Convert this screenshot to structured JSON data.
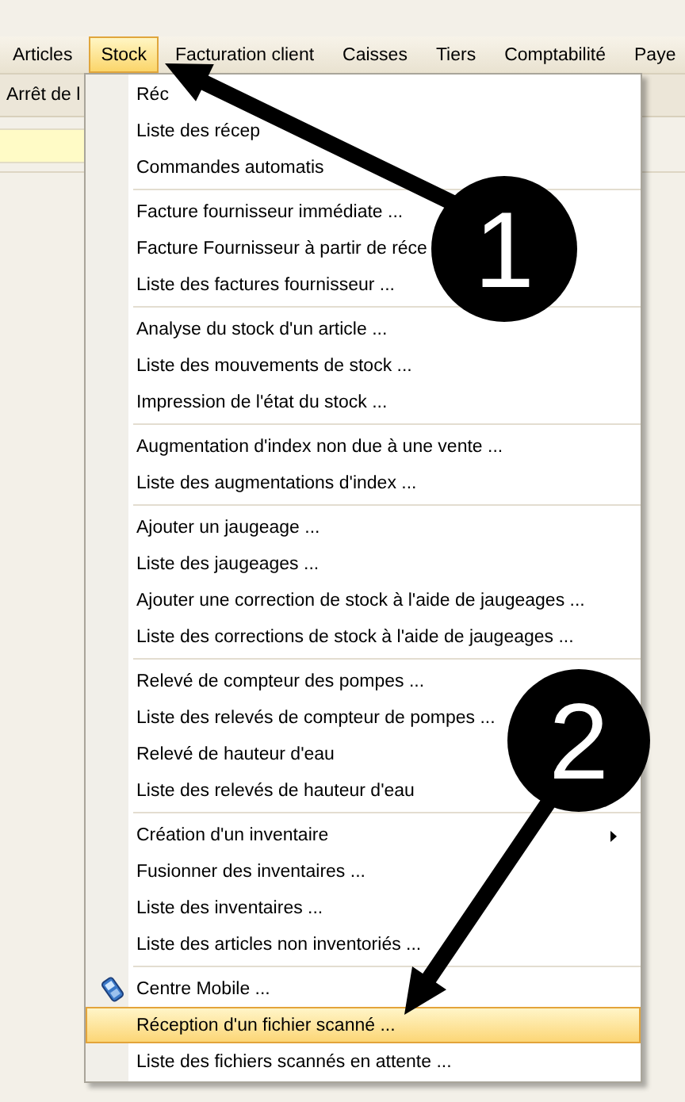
{
  "menu_bar": [
    {
      "label": "Articles",
      "selected": false
    },
    {
      "label": "Stock",
      "selected": true
    },
    {
      "label": "Facturation client",
      "selected": false
    },
    {
      "label": "Caisses",
      "selected": false
    },
    {
      "label": "Tiers",
      "selected": false
    },
    {
      "label": "Comptabilité",
      "selected": false
    },
    {
      "label": "Paye",
      "selected": false
    }
  ],
  "toolbar": {
    "button": "Arrêt de l"
  },
  "menu": [
    {
      "kind": "item",
      "label": "Réc",
      "selected": false
    },
    {
      "kind": "item",
      "label": "Liste des récep",
      "selected": false
    },
    {
      "kind": "item",
      "label": "Commandes automatis",
      "selected": false
    },
    {
      "kind": "separator"
    },
    {
      "kind": "item",
      "label": "Facture fournisseur immédiate ...",
      "selected": false
    },
    {
      "kind": "item",
      "label": "Facture Fournisseur à partir de réce",
      "selected": false
    },
    {
      "kind": "item",
      "label": "Liste des factures fournisseur ...",
      "selected": false
    },
    {
      "kind": "separator"
    },
    {
      "kind": "item",
      "label": "Analyse du stock d'un article ...",
      "selected": false
    },
    {
      "kind": "item",
      "label": "Liste des mouvements de stock ...",
      "selected": false
    },
    {
      "kind": "item",
      "label": "Impression de l'état du stock ...",
      "selected": false
    },
    {
      "kind": "separator"
    },
    {
      "kind": "item",
      "label": "Augmentation d'index non due à une vente ...",
      "selected": false
    },
    {
      "kind": "item",
      "label": "Liste des augmentations d'index ...",
      "selected": false
    },
    {
      "kind": "separator"
    },
    {
      "kind": "item",
      "label": "Ajouter un jaugeage ...",
      "selected": false
    },
    {
      "kind": "item",
      "label": "Liste des jaugeages ...",
      "selected": false
    },
    {
      "kind": "item",
      "label": "Ajouter une correction de stock à l'aide de jaugeages ...",
      "selected": false
    },
    {
      "kind": "item",
      "label": "Liste des corrections de stock à l'aide de jaugeages ...",
      "selected": false
    },
    {
      "kind": "separator"
    },
    {
      "kind": "item",
      "label": "Relevé de compteur des pompes ...",
      "selected": false
    },
    {
      "kind": "item",
      "label": "Liste des relevés de compteur de pompes ...",
      "selected": false
    },
    {
      "kind": "item",
      "label": "Relevé de hauteur d'eau",
      "selected": false
    },
    {
      "kind": "item",
      "label": "Liste des relevés de hauteur d'eau",
      "selected": false
    },
    {
      "kind": "separator"
    },
    {
      "kind": "submenu",
      "label": "Création d'un inventaire",
      "selected": false
    },
    {
      "kind": "item",
      "label": "Fusionner des inventaires ...",
      "selected": false
    },
    {
      "kind": "item",
      "label": "Liste des inventaires ...",
      "selected": false
    },
    {
      "kind": "item",
      "label": "Liste des articles non inventoriés ...",
      "selected": false
    },
    {
      "kind": "separator"
    },
    {
      "kind": "icon-item",
      "label": "Centre Mobile ...",
      "selected": false
    },
    {
      "kind": "item",
      "label": "Réception d'un fichier scanné ...",
      "selected": true
    },
    {
      "kind": "item",
      "label": "Liste des fichiers scannés en attente ...",
      "selected": false
    }
  ],
  "callouts": [
    {
      "number": "1"
    },
    {
      "number": "2"
    }
  ]
}
